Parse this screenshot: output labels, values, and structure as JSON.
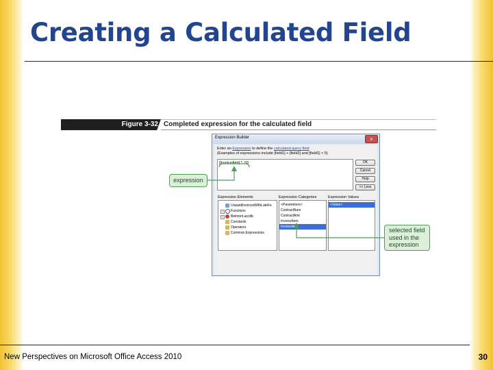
{
  "slide": {
    "title": "Creating a Calculated Field",
    "footer": "New Perspectives on Microsoft Office Access 2010",
    "page_number": "30"
  },
  "figure": {
    "number": "Figure 3-32",
    "caption": "Completed expression for the calculated field"
  },
  "dialog": {
    "title": "Expression Builder",
    "instruction_prefix": "Enter an ",
    "instruction_link1": "Expression",
    "instruction_middle": " to define the ",
    "instruction_link2": "calculated query field",
    "instruction_line2": "(Examples of expressions include [field1] + [field2] and [field1] < 5)",
    "expression_value": "[InvoiceAmt] * .03",
    "close_glyph": "x",
    "buttons": {
      "ok": "OK",
      "cancel": "Cancel",
      "help": "Help",
      "less": "<< Less"
    },
    "elements_label": "Expression Elements",
    "categories_label": "Expression Categories",
    "values_label": "Expression Values",
    "elements": [
      {
        "label": "UnpaidInvoicesWithLateFe",
        "pm": ""
      },
      {
        "label": "Functions",
        "pm": "+"
      },
      {
        "label": "Belmont.accdb",
        "pm": "+"
      },
      {
        "label": "Constants",
        "pm": ""
      },
      {
        "label": "Operators",
        "pm": ""
      },
      {
        "label": "Common Expressions",
        "pm": ""
      }
    ],
    "categories": [
      "<Parameters>",
      "ContractNum",
      "ContractAmt",
      "InvoiceItem",
      "InvoiceAmt"
    ],
    "values": [
      "<Value>"
    ]
  },
  "callouts": {
    "expression": "expression",
    "selected_field": [
      "selected field",
      "used in the",
      "expression"
    ]
  },
  "colors": {
    "title": "#23458f",
    "callout_border": "#4f9e57",
    "callout_fill": "#dcefd8",
    "selection": "#3a6fd8"
  }
}
